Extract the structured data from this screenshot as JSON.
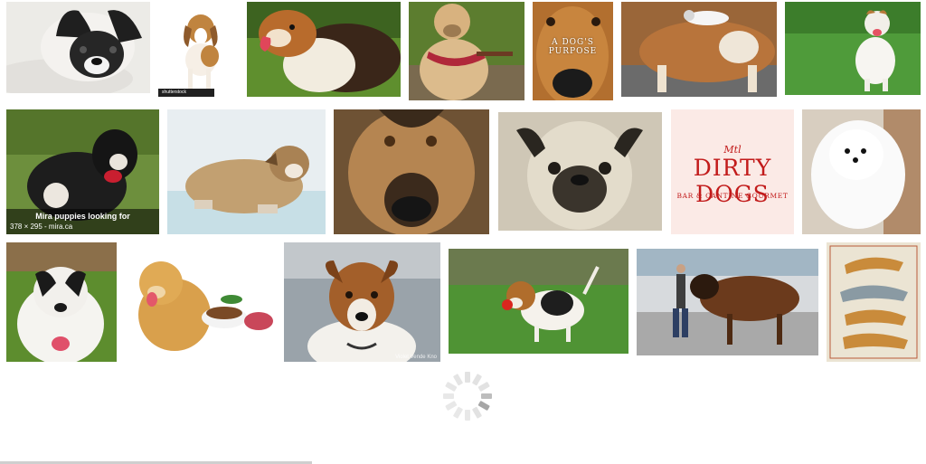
{
  "results": [
    {
      "label": "french bulldog lying on blanket"
    },
    {
      "label": "beagle puppy standing",
      "source_tag": "shutterstock"
    },
    {
      "label": "collie dog on grass"
    },
    {
      "label": "labrador with harness"
    },
    {
      "label": "dog nose close-up",
      "overlay_title": "A DOG'S PURPOSE"
    },
    {
      "label": "kitten riding a big dog"
    },
    {
      "label": "jack russell running on grass"
    },
    {
      "label": "black and white puppy",
      "caption_title": "Mira puppies looking for",
      "caption_meta": "378 × 295 - mira.ca"
    },
    {
      "label": "sleepy tan puppy"
    },
    {
      "label": "shepherd mix face"
    },
    {
      "label": "pug face"
    },
    {
      "label": "Dirty Dogs restaurant logo",
      "logo": {
        "mtl": "Mtl",
        "name": "DIRTY DOGS",
        "tagline": "BAR & CANTINE GOURMET"
      }
    },
    {
      "label": "white pomeranian"
    },
    {
      "label": "black and white terrier"
    },
    {
      "label": "golden retriever with dog food"
    },
    {
      "label": "jack russell portrait",
      "watermark": "Violet Vende Kno"
    },
    {
      "label": "beagle puppy with red ball"
    },
    {
      "label": "leonberger walking with owner"
    },
    {
      "label": "medieval dog illustration"
    }
  ],
  "spinner": {
    "state": "loading"
  },
  "colors": {
    "logo_red": "#c21b1b",
    "logo_bg": "#fbeae6",
    "spinner": "#bdbdbd"
  }
}
